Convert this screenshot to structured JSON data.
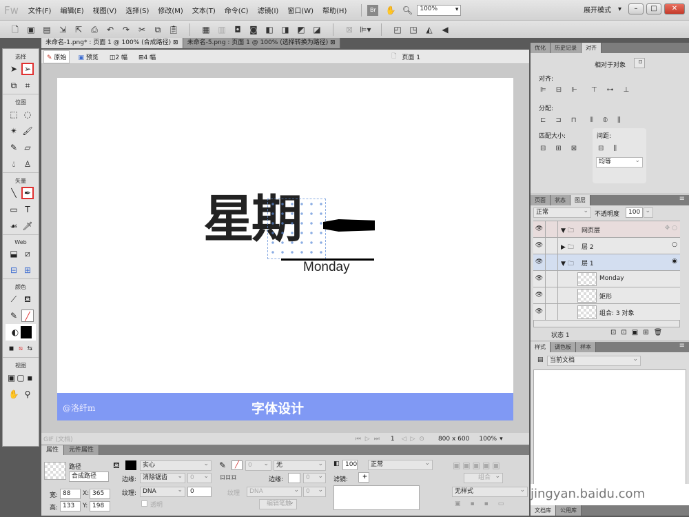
{
  "app": {
    "logo": "Fw",
    "menus": [
      "文件(F)",
      "编辑(E)",
      "视图(V)",
      "选择(S)",
      "修改(M)",
      "文本(T)",
      "命令(C)",
      "滤镜(I)",
      "窗口(W)",
      "帮助(H)"
    ],
    "zoom": "100%",
    "workspace": "展开模式"
  },
  "doc_tabs": [
    {
      "label": "未命名-1.png* : 页面 1 @ 100% (合成路径)"
    },
    {
      "label": "未命名-5.png : 页面 1 @ 100% (选择转换为路径)"
    }
  ],
  "view_bar": {
    "original": "原始",
    "preview": "预览",
    "two_up": "2 幅",
    "four_up": "4 幅",
    "page": "页面 1"
  },
  "tools": {
    "select": "选择",
    "bitmap": "位图",
    "vector": "矢量",
    "web": "Web",
    "colors": "颜色",
    "view": "视图"
  },
  "canvas": {
    "title_chars": "星期",
    "title_dash": "一",
    "subtitle": "Monday",
    "band_text": "字体设计",
    "watermark": "@洛纤m",
    "band_color": "#8099f4"
  },
  "status": {
    "format": "GIF (文档)",
    "frame": "1",
    "size": "800 x 600",
    "zoom": "100%"
  },
  "props": {
    "tabs": [
      "属性",
      "元件属性"
    ],
    "type": "路径",
    "name": "合成路径",
    "w_label": "宽:",
    "w": "88",
    "h_label": "高:",
    "h": "133",
    "x_label": "X:",
    "x": "365",
    "y_label": "Y:",
    "y": "198",
    "fill": "实心",
    "edge_label": "边缘:",
    "edge": "消除锯齿",
    "edge_val": "0",
    "texture_label": "纹理:",
    "texture": "DNA",
    "texture_val": "0",
    "transparent": "透明",
    "stroke_size": "0",
    "stroke": "无",
    "stroke_edge_label": "边缘:",
    "stroke_edge_val": "0",
    "stroke_texture_label": "纹理",
    "stroke_texture": "DNA",
    "stroke_texture_val": "0",
    "edit_stroke": "编辑笔触",
    "opacity": "100",
    "blend": "正常",
    "filters_label": "滤镜:",
    "group": "组合",
    "style": "无样式"
  },
  "align_panel": {
    "tabs": [
      "优化",
      "历史记录",
      "对齐"
    ],
    "relative": "相对于对象",
    "align": "对齐:",
    "distribute": "分配:",
    "match": "匹配大小:",
    "spacing": "间距:",
    "spacing_mode": "均等"
  },
  "layers_panel": {
    "tabs": [
      "页面",
      "状态",
      "图层"
    ],
    "blend": "正常",
    "opacity_label": "不透明度",
    "opacity": "100",
    "rows": [
      {
        "name": "网页层"
      },
      {
        "name": "层 2"
      },
      {
        "name": "层 1"
      },
      {
        "name": "Monday"
      },
      {
        "name": "矩形"
      },
      {
        "name": "组合: 3 对象"
      }
    ],
    "state": "状态 1"
  },
  "styles_panel": {
    "tabs": [
      "样式",
      "调色板",
      "样本"
    ],
    "source": "当前文档"
  },
  "library_tabs": [
    "文档库",
    "公用库"
  ],
  "watermark": "jingyan.baidu.com"
}
